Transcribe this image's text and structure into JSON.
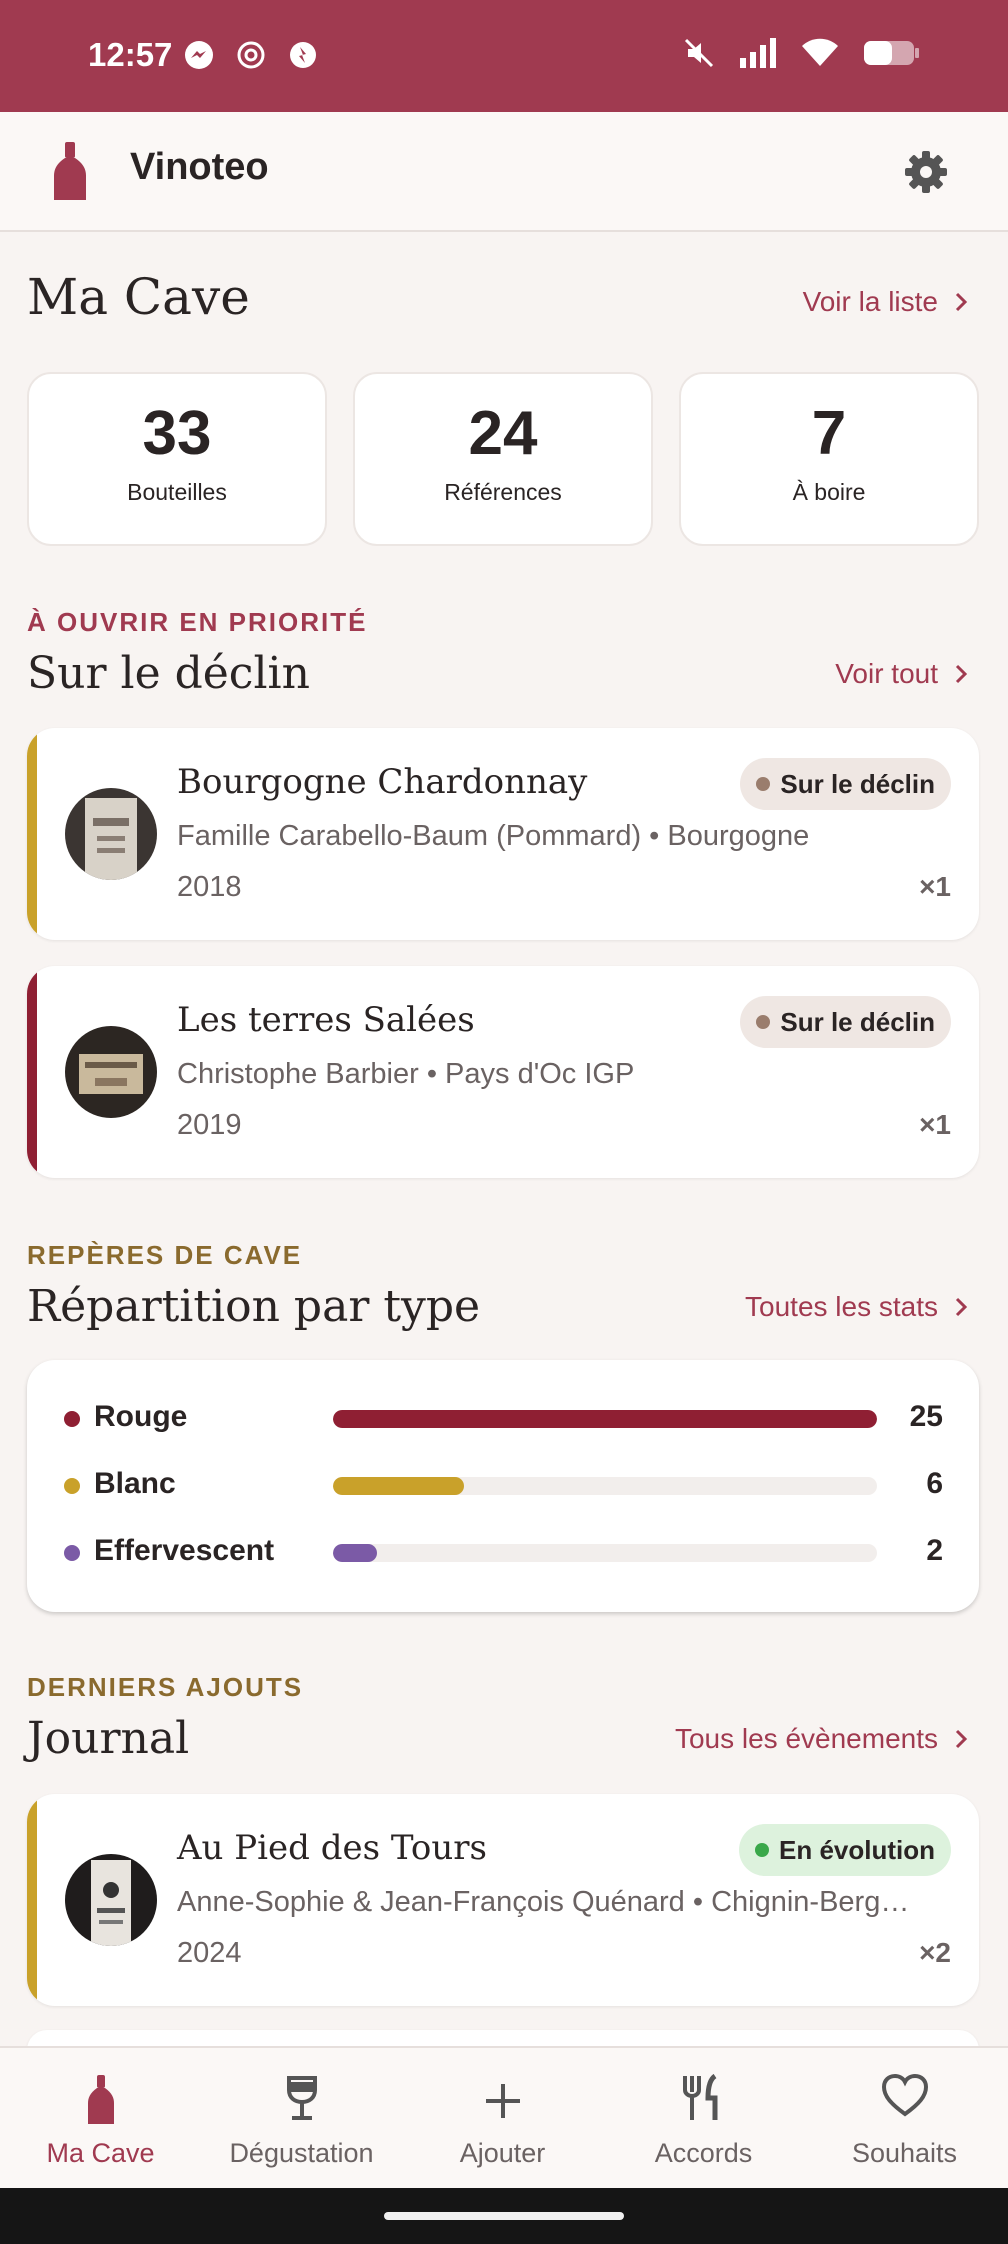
{
  "status_bar": {
    "time": "12:57"
  },
  "app": {
    "title": "Vinoteo"
  },
  "cave": {
    "title": "Ma Cave",
    "link": "Voir la liste",
    "stats": [
      {
        "value": "33",
        "label": "Bouteilles"
      },
      {
        "value": "24",
        "label": "Références"
      },
      {
        "value": "7",
        "label": "À boire"
      }
    ]
  },
  "priority": {
    "overline": "À OUVRIR EN PRIORITÉ",
    "title": "Sur le déclin",
    "link": "Voir tout",
    "items": [
      {
        "name": "Bourgogne Chardonnay",
        "producer": "Famille Carabello-Baum (Pommard) • Bourgogne",
        "year": "2018",
        "qty": "×1",
        "badge": "Sur le déclin",
        "stripe_color": "#c9a12a",
        "badge_bg": "#efe7e3",
        "badge_dot": "#9a7d6d"
      },
      {
        "name": "Les terres Salées",
        "producer": "Christophe Barbier • Pays d'Oc IGP",
        "year": "2019",
        "qty": "×1",
        "badge": "Sur le déclin",
        "stripe_color": "#8f1f33",
        "badge_bg": "#efe7e3",
        "badge_dot": "#9a7d6d"
      }
    ]
  },
  "reperes": {
    "overline": "REPÈRES DE CAVE",
    "title": "Répartition par type",
    "link": "Toutes les stats",
    "rows": [
      {
        "label": "Rouge",
        "count": "25",
        "fraction": 1.0,
        "color": "#8f1f33"
      },
      {
        "label": "Blanc",
        "count": "6",
        "fraction": 0.24,
        "color": "#c9a12a"
      },
      {
        "label": "Effervescent",
        "count": "2",
        "fraction": 0.08,
        "color": "#7b5aa6"
      }
    ]
  },
  "journal": {
    "overline": "DERNIERS AJOUTS",
    "title": "Journal",
    "link": "Tous les évènements",
    "items": [
      {
        "name": "Au Pied des Tours",
        "producer": "Anne-Sophie & Jean-François Quénard • Chignin-Berg…",
        "year": "2024",
        "qty": "×2",
        "badge": "En évolution",
        "stripe_color": "#c9a12a",
        "badge_bg": "#ddf2dd",
        "badge_dot": "#3aa84a"
      }
    ]
  },
  "nav": [
    {
      "label": "Ma Cave",
      "icon": "bottle-icon",
      "active": true
    },
    {
      "label": "Dégustation",
      "icon": "wine-glass-icon",
      "active": false
    },
    {
      "label": "Ajouter",
      "icon": "plus-icon",
      "active": false
    },
    {
      "label": "Accords",
      "icon": "fork-knife-icon",
      "active": false
    },
    {
      "label": "Souhaits",
      "icon": "heart-icon",
      "active": false
    }
  ],
  "colors": {
    "brand": "#a03a50",
    "accent_gold": "#8a6a2e",
    "background": "#f8f4f2"
  }
}
